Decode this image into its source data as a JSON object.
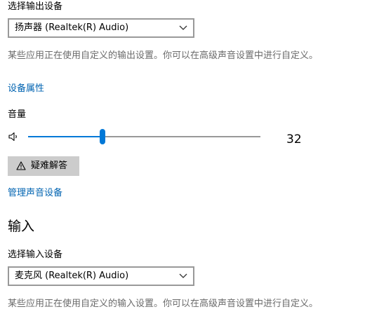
{
  "output": {
    "select_label": "选择输出设备",
    "device_value": "扬声器 (Realtek(R) Audio)",
    "description": "某些应用正在使用自定义的输出设置。你可以在高级声音设置中进行自定义。",
    "device_properties_link": "设备属性",
    "volume_label": "音量",
    "volume_value": "32",
    "volume_fraction": 0.32,
    "troubleshoot_label": "疑难解答",
    "manage_link": "管理声音设备"
  },
  "input": {
    "section_title": "输入",
    "select_label": "选择输入设备",
    "device_value": "麦克风 (Realtek(R) Audio)",
    "description": "某些应用正在使用自定义的输入设置。你可以在高级声音设置中进行自定义。"
  },
  "icons": {
    "speaker": "speaker-icon",
    "warning": "warning-triangle-icon",
    "chevron": "chevron-down-icon"
  },
  "colors": {
    "accent": "#0078d7",
    "link": "#0063b1",
    "muted_text": "#6b6b6b"
  }
}
